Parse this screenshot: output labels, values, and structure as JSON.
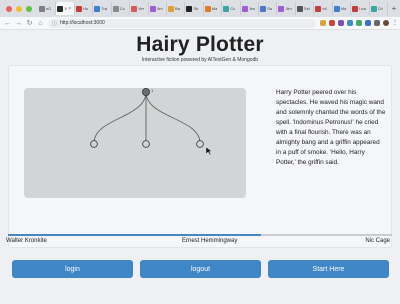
{
  "browser": {
    "tabs": [
      {
        "title": "nG",
        "color": "#7b7f86"
      },
      {
        "title": "X",
        "color": "#2b2b2b",
        "active": true
      },
      {
        "title": "Ho",
        "color": "#c43c3c"
      },
      {
        "title": "Tra",
        "color": "#3f7fd1"
      },
      {
        "title": "Co",
        "color": "#8a8a8a"
      },
      {
        "title": "Ver",
        "color": "#d55a5a"
      },
      {
        "title": "Jim",
        "color": "#a05fcf"
      },
      {
        "title": "Ba",
        "color": "#e0a12e"
      },
      {
        "title": "Sh",
        "color": "#222222"
      },
      {
        "title": "Ma",
        "color": "#e07b28"
      },
      {
        "title": "Co",
        "color": "#3aa6a0"
      },
      {
        "title": "Jim",
        "color": "#a05fcf"
      },
      {
        "title": "Sa",
        "color": "#4d78c8"
      },
      {
        "title": "Jim",
        "color": "#a05fcf"
      },
      {
        "title": "Sel",
        "color": "#555555"
      },
      {
        "title": "Inl",
        "color": "#c43c3c"
      },
      {
        "title": "Ma",
        "color": "#3f7fd1"
      },
      {
        "title": "Lea",
        "color": "#c43c3c"
      },
      {
        "title": "Ch",
        "color": "#3aa6a0"
      }
    ],
    "url": "http://localhost:3000",
    "new_tab_label": "+"
  },
  "page": {
    "title": "Hairy Plotter",
    "subtitle": "Interactive fiction powered by AITextGen & Mongodb",
    "story": "Harry Potter peered over his spectacles. He waved his magic wand and solemnly chanted the words of the spell. 'Indominus Petronus!' he cried with a final flourish. There was an almighty bang and a griffin appeared in a puff of smoke. 'Hello, Harry Potter,' the griffin said.",
    "tree_root_label": "1",
    "progress_fraction": 0.66,
    "names": {
      "left": "Walter Kronkite",
      "center": "Ernest Hemmingway",
      "right": "Nic Cage"
    },
    "buttons": {
      "login": "login",
      "logout": "logout",
      "start": "Start Here"
    }
  },
  "colors": {
    "accent": "#3f86c6",
    "canvas_bg": "#d3d4d6",
    "light_red": "#ee5f57",
    "light_yellow": "#f5bd30",
    "light_green": "#5fc43e"
  }
}
